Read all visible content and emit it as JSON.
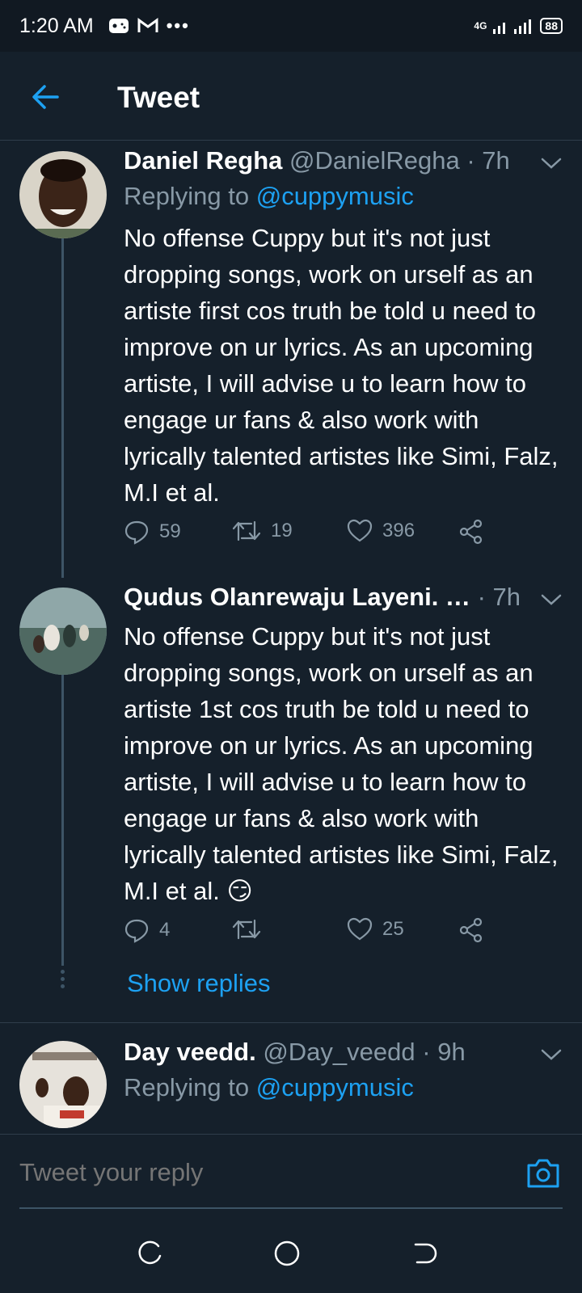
{
  "status_bar": {
    "time": "1:20 AM",
    "dots": "•••",
    "network": "4G",
    "battery": "88"
  },
  "header": {
    "title": "Tweet"
  },
  "tweets": [
    {
      "name": "Daniel Regha",
      "handle": "@DanielRegha",
      "time": "· 7h",
      "replying_prefix": "Replying to ",
      "replying_to": "@cuppymusic",
      "body": "No offense Cuppy but it's not just dropping songs, work on urself as an artiste first cos truth be told u need to improve on ur lyrics. As an upcoming artiste, I will advise u to learn how to engage ur fans & also work with lyrically talented artistes like Simi, Falz, M.I et al.",
      "replies": "59",
      "retweets": "19",
      "likes": "396"
    },
    {
      "name": "Qudus Olanrewaju Layeni. …",
      "handle": "",
      "time": "· 7h",
      "body": "No offense Cuppy but it's not just dropping songs, work on urself as an artiste 1st cos truth be told u need to improve on ur lyrics. As an upcoming artiste, I will advise u to learn how to engage ur fans & also work with lyrically talented artistes like Simi, Falz, M.I et al. 😏",
      "replies": "4",
      "retweets": "",
      "likes": "25",
      "show_replies": "Show replies"
    },
    {
      "name": "Day veedd.",
      "handle": "@Day_veedd",
      "time": "· 9h",
      "replying_prefix": "Replying to ",
      "replying_to": "@cuppymusic"
    }
  ],
  "reply_bar": {
    "placeholder": "Tweet your reply"
  },
  "colors": {
    "background": "#15202b",
    "accent": "#1da1f2",
    "muted": "#8899a6"
  }
}
